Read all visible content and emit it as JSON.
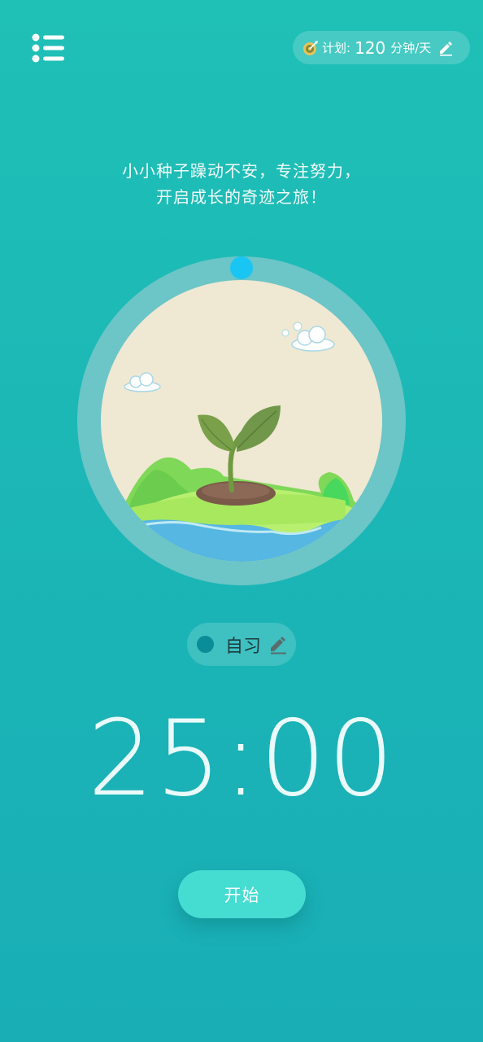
{
  "header": {
    "menu_icon": "list-menu-icon",
    "plan": {
      "icon": "target-icon",
      "label": "计划:",
      "minutes": "120",
      "unit": "分钟/天",
      "edit_icon": "pencil-icon"
    }
  },
  "slogan": {
    "line1": "小小种子躁动不安，专注努力，",
    "line2": "开启成长的奇迹之旅！"
  },
  "dial": {
    "illustration": "sprout-on-hill-illustration",
    "progress": 0,
    "colors": {
      "ring": "#6cc5c6",
      "knob": "#19c5f3",
      "sky": "#efe8d3"
    }
  },
  "tag": {
    "label": "自习",
    "dot_color": "#0b8d98",
    "edit_icon": "pencil-icon"
  },
  "timer": {
    "display": "25:00"
  },
  "start_button": {
    "label": "开始"
  },
  "colors": {
    "background": "#1cbab6",
    "button": "#45dcd2"
  }
}
